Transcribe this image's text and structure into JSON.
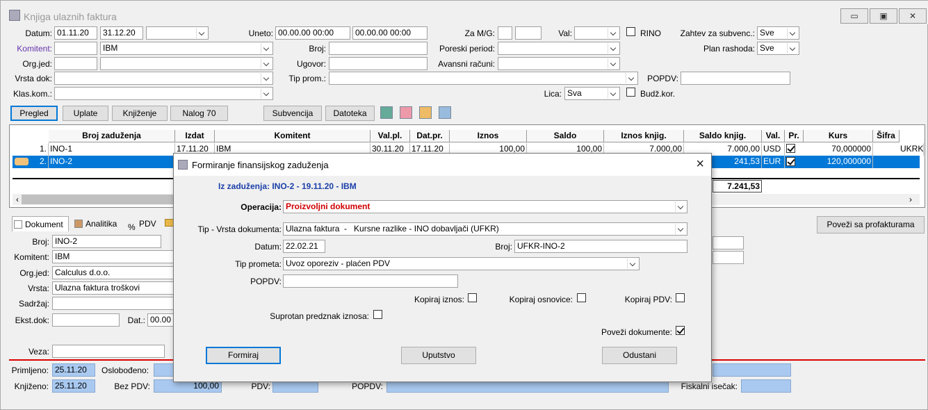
{
  "window": {
    "title": "Knjiga ulaznih faktura",
    "min": "▭",
    "max": "▣",
    "close": "✕"
  },
  "filters": {
    "datum_label": "Datum:",
    "datum_from": "01.11.20",
    "datum_to": "31.12.20",
    "datum_sel": "",
    "uneto_label": "Uneto:",
    "uneto_from": "00.00.00 00:00",
    "uneto_to": "00.00.00 00:00",
    "zamg_label": "Za M/G:",
    "zamg_1": "",
    "zamg_2": "",
    "val_label": "Val:",
    "val_value": "",
    "rino_label": "RINO",
    "zahtev_label": "Zahtev za subvenc.:",
    "zahtev_value": "Sve",
    "komitent_label": "Komitent:",
    "komitent_code": "",
    "komitent_name": "IBM",
    "broj_label": "Broj:",
    "broj_value": "",
    "poreski_label": "Poreski period:",
    "poreski_value": "",
    "plan_label": "Plan rashoda:",
    "plan_value": "Sve",
    "orgjed_label": "Org.jed:",
    "orgjed_code": "",
    "orgjed_name": "",
    "ugovor_label": "Ugovor:",
    "ugovor_value": "",
    "avansni_label": "Avansni računi:",
    "avansni_value": "",
    "vrsta_label": "Vrsta dok:",
    "vrsta_value": "",
    "tipprom_label": "Tip prom.:",
    "tipprom_value": "",
    "popdv_label": "POPDV:",
    "popdv_value": "",
    "klas_label": "Klas.kom.:",
    "klas_value": "",
    "lica_label": "Lica:",
    "lica_value": "Sva",
    "budz_label": "Budž.kor."
  },
  "toolbar": {
    "pregled": "Pregled",
    "uplate": "Uplate",
    "knjizenje": "Knjiženje",
    "nalog": "Nalog 70",
    "subvencija": "Subvencija",
    "datoteka": "Datoteka"
  },
  "grid": {
    "headers": [
      "Broj zaduženja",
      "Izdat",
      "Komitent",
      "Val.pl.",
      "Dat.pr.",
      "Iznos",
      "Saldo",
      "Iznos knjig.",
      "Saldo knjig.",
      "Val.",
      "Pr.",
      "Kurs",
      "Šifra"
    ],
    "rows": [
      {
        "n": "1.",
        "broj": "INO-1",
        "izdat": "17.11.20",
        "komitent": "IBM",
        "valpl": "30.11.20",
        "datpr": "17.11.20",
        "iznos": "100,00",
        "saldo": "100,00",
        "iznosk": "7.000,00",
        "saldok": "7.000,00",
        "val": "USD",
        "kurs": "70,000000",
        "sifra": "UKRK"
      },
      {
        "n": "2.",
        "broj": "INO-2",
        "saldok": "241,53",
        "val": "EUR",
        "kurs": "120,000000"
      }
    ],
    "total": "7.241,53"
  },
  "tabs": {
    "dokument": "Dokument",
    "analitika": "Analitika",
    "pdv": "PDV"
  },
  "povezi_btn": "Poveži sa profakturama",
  "detail": {
    "broj_label": "Broj:",
    "broj": "INO-2",
    "komitent_label": "Komitent:",
    "komitent": "IBM",
    "orgjed_label": "Org.jed:",
    "orgjed": "Calculus d.o.o.",
    "vrsta_label": "Vrsta:",
    "vrsta": "Ulazna faktura troškovi",
    "sadrzaj_label": "Sadržaj:",
    "sadrzaj": "",
    "ekst_label": "Ekst.dok:",
    "ekst": "",
    "dat_label": "Dat.:",
    "dat": "00.00",
    "veza_label": "Veza:",
    "veza": "",
    "primljeno_label": "Primljeno:",
    "primljeno": "25.11.20",
    "oslobodeno_label": "Oslobođeno:",
    "knjizeno_label": "Knjiženo:",
    "knjizeno": "25.11.20",
    "bezpdv_label": "Bez PDV:",
    "bezpdv": "100,00",
    "pdv_label": "PDV:",
    "popdv_label": "POPDV:",
    "fiskalni_label": "Fiskalni isečak:"
  },
  "dialog": {
    "title": "Formiranje finansijskog zaduženja",
    "iz": "Iz zaduženja: INO-2 - 19.11.20 - IBM",
    "operacija_label": "Operacija:",
    "operacija": "Proizvoljni dokument",
    "tip_label": "Tip - Vrsta dokumenta:",
    "tip": "Ulazna faktura  -   Kursne razlike - INO dobavljači (UFKR)",
    "datum_label": "Datum:",
    "datum": "22.02.21",
    "broj_label": "Broj:",
    "broj": "UFKR-INO-2",
    "tipprom_label": "Tip prometa:",
    "tipprom": "Uvoz oporeziv - plaćen PDV",
    "popdv_label": "POPDV:",
    "popdv": "",
    "kiznos": "Kopiraj iznos:",
    "kosnov": "Kopiraj osnovice:",
    "kpdv": "Kopiraj PDV:",
    "suprotan": "Suprotan predznak iznosa:",
    "povezi": "Poveži dokumente:",
    "formiraj": "Formiraj",
    "uputstvo": "Uputstvo",
    "odustani": "Odustani"
  }
}
